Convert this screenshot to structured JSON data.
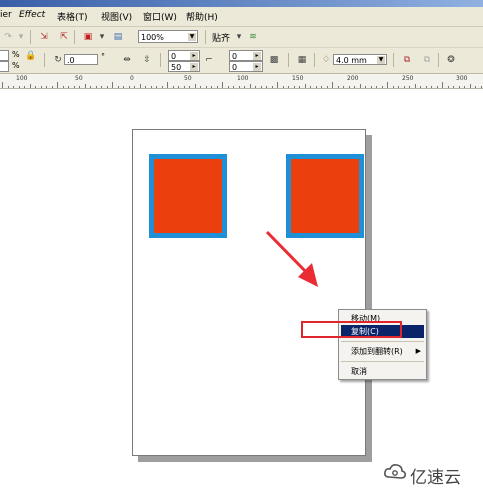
{
  "menubar": {
    "items": [
      "ier",
      "Effect",
      "表格(T)",
      "视图(V)",
      "窗口(W)",
      "帮助(H)"
    ]
  },
  "toolbar1": {
    "zoom_value": "100%",
    "snap_label": "贴齐"
  },
  "toolbar2": {
    "percent_1": "%",
    "percent_2": "%",
    "rotation_value": ".0",
    "degree_symbol": "°",
    "x_offset_top": "0",
    "x_offset_bottom": "50",
    "y_offset_top": "0",
    "y_offset_bottom": "0",
    "outline_width": "4.0 mm"
  },
  "ruler": {
    "labels": [
      "100",
      "50",
      "0",
      "50",
      "100",
      "150",
      "200",
      "250",
      "300"
    ]
  },
  "context_menu": {
    "items": [
      {
        "label": "移动(M)"
      },
      {
        "label": "复制(C)",
        "selected": true
      },
      {
        "label": "添加到翻转(R)",
        "has_submenu": true
      },
      {
        "label": "取消"
      }
    ]
  },
  "watermark": {
    "text": "亿速云"
  },
  "colors": {
    "square_fill": "#eb3f0e",
    "square_outline": "#1f8fd6",
    "highlight_red": "#e0262a",
    "menu_selection": "#0a246a",
    "arrow": "#ea2c34"
  }
}
